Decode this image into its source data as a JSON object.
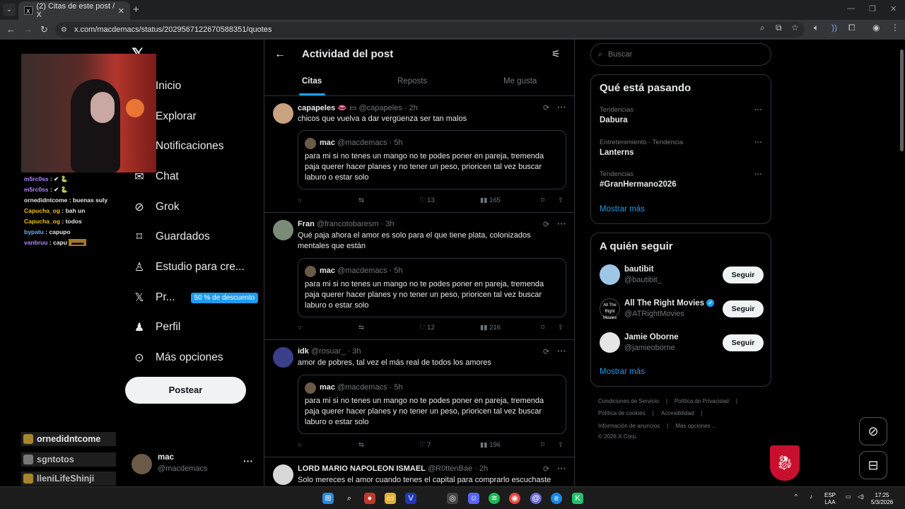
{
  "browser": {
    "tab_title": "(2) Citas de este post / X",
    "url": "x.com/macdemacs/status/2029567122670588351/quotes"
  },
  "stream": {
    "chat_lines": [
      {
        "user": "m5rc0ss",
        "text": ":"
      },
      {
        "user": "m5rc0ss",
        "text": ":"
      },
      {
        "user": "ornedidntcome",
        "text": ": buenas suly"
      },
      {
        "user": "Capucha_og",
        "text": ": bah un"
      },
      {
        "user": "Capucha_og",
        "text": ": todos"
      },
      {
        "user": "bypatu",
        "text": ": capupo"
      },
      {
        "user": "vanbruu",
        "text": ": capu"
      }
    ],
    "big_names": [
      "ornedidntcome",
      "sgntotos",
      "lleniLifeShinji"
    ]
  },
  "sidebar": {
    "items": [
      {
        "label": "Inicio",
        "icon": "home-icon"
      },
      {
        "label": "Explorar",
        "icon": "search-icon"
      },
      {
        "label": "Notificaciones",
        "icon": "bell-icon"
      },
      {
        "label": "Chat",
        "icon": "mail-icon"
      },
      {
        "label": "Grok",
        "icon": "grok-icon"
      },
      {
        "label": "Guardados",
        "icon": "bookmark-icon"
      },
      {
        "label": "Estudio para cre...",
        "icon": "studio-icon"
      },
      {
        "label": "Pr...",
        "icon": "x-premium-icon",
        "badge": "50 % de descuento"
      },
      {
        "label": "Perfil",
        "icon": "user-icon"
      },
      {
        "label": "Más opciones",
        "icon": "more-circle-icon"
      }
    ],
    "post_button": "Postear",
    "account": {
      "name": "mac",
      "handle": "@macdemacs"
    }
  },
  "main": {
    "title": "Actividad del post",
    "tabs": [
      "Citas",
      "Reposts",
      "Me gusta"
    ],
    "active_tab": "Citas",
    "posts": [
      {
        "name": "capapeles",
        "handle": "@capapeles",
        "time": "· 2h",
        "text": "chicos que vuelva a dar vergüenza ser tan malos",
        "quote": {
          "name": "mac",
          "handle": "@macdemacs",
          "time": "· 5h",
          "text": "para mi si no tenes un mango no te podes poner en pareja, tremenda paja querer hacer planes y no tener un peso, prioricen tal vez buscar laburo o estar solo"
        },
        "likes": "13",
        "views": "165"
      },
      {
        "name": "Fran",
        "handle": "@francotobaresm",
        "time": "· 3h",
        "text": "Qué paja ahora el amor es solo para el que tiene plata, colonizados mentales que están",
        "quote": {
          "name": "mac",
          "handle": "@macdemacs",
          "time": "· 5h",
          "text": "para mi si no tenes un mango no te podes poner en pareja, tremenda paja querer hacer planes y no tener un peso, prioricen tal vez buscar laburo o estar solo"
        },
        "likes": "12",
        "views": "216"
      },
      {
        "name": "idk",
        "handle": "@rosuar_",
        "time": "· 3h",
        "text": "amor de pobres, tal vez el más real de todos los amores",
        "quote": {
          "name": "mac",
          "handle": "@macdemacs",
          "time": "· 5h",
          "text": "para mi si no tenes un mango no te podes poner en pareja, tremenda paja querer hacer planes y no tener un peso, prioricen tal vez buscar laburo o estar solo"
        },
        "likes": "7",
        "views": "196"
      },
      {
        "name": "LORD MARIO NAPOLEON ISMAEL",
        "handle": "@R0ttenBae",
        "time": "· 2h",
        "text": "Solo mereces el amor cuando tenes el capital para comprarlo escuchaste"
      }
    ]
  },
  "right": {
    "search_placeholder": "Buscar",
    "trends_title": "Qué está pasando",
    "trends": [
      {
        "context": "Tendencias",
        "name": "Dabura"
      },
      {
        "context": "Entretenimiento · Tendencia",
        "name": "Lanterns"
      },
      {
        "context": "Tendencias",
        "name": "#GranHermano2026"
      }
    ],
    "show_more": "Mostrar más",
    "who_title": "A quién seguir",
    "who": [
      {
        "name": "bautibit",
        "handle": "@bautibit_",
        "button": "Seguir",
        "verified": false
      },
      {
        "name": "All The Right Movies",
        "handle": "@ATRightMovies",
        "button": "Seguir",
        "verified": true
      },
      {
        "name": "Jamie Oborne",
        "handle": "@jamieoborne",
        "button": "Seguir",
        "verified": false
      }
    ],
    "footer": [
      [
        "Condiciones de Servicio",
        "Política de Privacidad"
      ],
      [
        "Política de cookies",
        "Accesibilidad"
      ],
      [
        "Información de anuncios",
        "Más opciones ..."
      ],
      [
        "© 2026 X Corp."
      ]
    ]
  },
  "taskbar": {
    "lang_top": "ESP",
    "lang_bottom": "LAA",
    "time": "17:25",
    "date": "5/3/2026"
  },
  "colors": {
    "accent": "#1d9bf0",
    "border": "#2f3336",
    "muted": "#71767b"
  }
}
